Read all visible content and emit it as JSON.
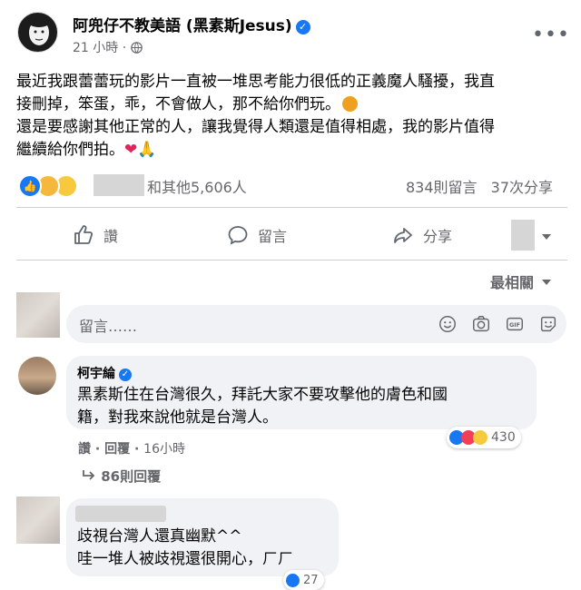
{
  "post": {
    "author": "阿兜仔不教美語 (黑素斯Jesus)",
    "time": "21 小時",
    "time_sep": "·",
    "body_lines": [
      "最近我跟蕾蕾玩的影片一直被一堆思考能力很低的正義魔人騷擾，我直",
      "接刪掉，笨蛋，乖，不會做人，那不給你們玩。",
      "還是要感謝其他正常的人，讓我覺得人類還是值得相處，我的影片值得",
      "繼續給你們拍。"
    ],
    "reactions_text": "和其他5,606人",
    "comments_count": "834則留言",
    "shares_count": "37次分享"
  },
  "actions": {
    "like": "讚",
    "comment": "留言",
    "share": "分享"
  },
  "sort_label": "最相關",
  "comment_input": {
    "placeholder": "留言……"
  },
  "comments": [
    {
      "name": "柯宇綸",
      "lines": [
        "黑素斯住在台灣很久，拜託大家不要攻擊他的膚色和國",
        "籍，對我來說他就是台灣人。"
      ],
      "like": "讚",
      "reply": "回覆",
      "time": "16小時",
      "reactions": "430",
      "replies": "86則回覆"
    },
    {
      "lines": [
        "歧視台灣人還真幽默^^",
        "哇一堆人被歧視還很開心，ㄏㄏ"
      ],
      "reactions": "27"
    }
  ],
  "colors": {
    "accent": "#1877f2",
    "secondary_text": "#65676b",
    "bubble": "#f0f2f5"
  }
}
